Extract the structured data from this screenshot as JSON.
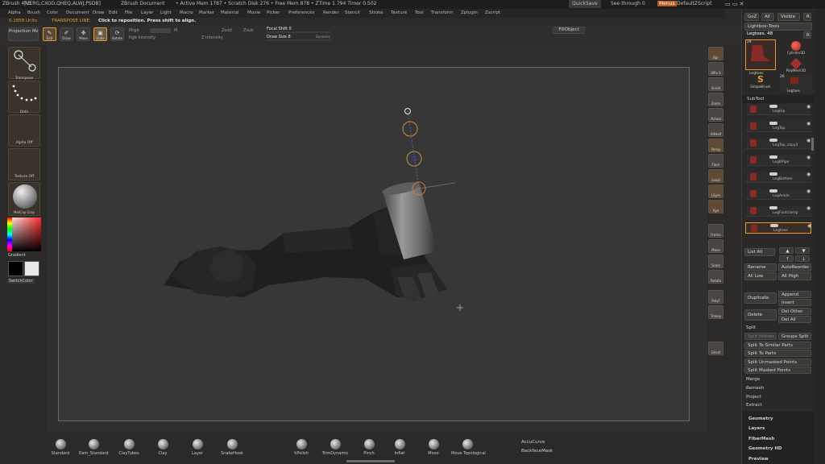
{
  "titlebar": {
    "app": "ZBrush 4R5",
    "build": "[VERG,CXOD,QHEQ,ALWJ,PSDB]",
    "doc": "ZBrush Document",
    "mem": "• Active Mem 1787 • Scratch Disk 276 • Free Mem 878 • ZTime 1.794 Timer 0.502",
    "quicksave": "QuickSave",
    "seethrough": "See-through 0",
    "menus": "Menus",
    "script": "DefaultZScript"
  },
  "menubar": [
    "Alpha",
    "Brush",
    "Color",
    "Document",
    "Draw",
    "Edit",
    "File",
    "Layer",
    "Light",
    "Macro",
    "Marker",
    "Material",
    "Movie",
    "Picker",
    "Preferences",
    "Render",
    "Stencil",
    "Stroke",
    "Texture",
    "Tool",
    "Transform",
    "Zplugin",
    "Zscript"
  ],
  "status": {
    "units": "0.1858 Units",
    "mode": "TRANSPOSE LINE:",
    "hint": "Click to reposition. Press shift to align."
  },
  "toolbar": {
    "projection_master": "Projection Master",
    "edit": "Edit",
    "draw": "Draw",
    "move": "Move",
    "scale": "Scale",
    "rotate": "Rotate",
    "mrgb": "Mrgb",
    "rgb": "Rgb",
    "m": "M",
    "zadd": "Zadd",
    "zsub": "Zsub",
    "rgb_intensity": "Rgb Intensity",
    "z_intensity": "Z Intensity",
    "focal_shift": "Focal Shift 0",
    "draw_size": "Draw Size 8",
    "dynamic": "Dynamic",
    "fill_object": "FillObject"
  },
  "left": {
    "transpose": "Transpose",
    "dots": "Dots",
    "alpha_off": "Alpha Off",
    "texture_off": "Texture Off",
    "material": "MatCap Gray",
    "gradient": "Gradient",
    "switch_color": "SwitchColor"
  },
  "right_shelf": [
    "Bpr",
    "SPix 3",
    "Scroll",
    "Zoom",
    "Actual",
    "AAHalf",
    "Persp",
    "Floor",
    "Local",
    "LSym",
    "Xyz",
    "Frame",
    "Move",
    "Scale",
    "Rotate",
    "PolyF",
    "Transp",
    "Ghost"
  ],
  "panel": {
    "goz": "GoZ",
    "all": "All",
    "visible": "Visible",
    "r": "R",
    "lightbox_tools": "Lightbox›Tools",
    "tool_name": "Legtoes. 48",
    "tools": [
      {
        "name": "Legtoes",
        "count": "24"
      },
      {
        "name": "Cylinder3D",
        "count": ""
      },
      {
        "name": "PolyMesh3D",
        "count": ""
      },
      {
        "name": "SimpleBrush",
        "count": ""
      },
      {
        "name": "Legtoes",
        "count": "26"
      }
    ],
    "subtool_title": "SubTool",
    "subtools": [
      "LegHip",
      "LegTop",
      "LegTop_copy1",
      "LegKPipe",
      "LegBottom",
      "LegAnkle",
      "LegFootclamp",
      "Legtoes"
    ],
    "list_all": "List All",
    "rename": "Rename",
    "auto_reorder": "AutoReorder",
    "all_low": "All Low",
    "all_high": "All High",
    "duplicate": "Duplicate",
    "append": "Append",
    "insert": "Insert",
    "delete": "Delete",
    "del_other": "Del Other",
    "del_all": "Del All",
    "split": "Split",
    "split_hidden": "Split Hidden",
    "groups_split": "Groups Split",
    "split_similar": "Split To Similar Parts",
    "split_parts": "Split To Parts",
    "split_unmasked": "Split Unmasked Points",
    "split_masked": "Split Masked Points",
    "merge": "Merge",
    "remesh": "Remesh",
    "project": "Project",
    "extract": "Extract",
    "geometry": "Geometry",
    "layers": "Layers",
    "fibermesh": "FiberMesh",
    "geometry_hd": "Geometry HD",
    "preview": "Preview"
  },
  "brushes": [
    "Standard",
    "Dam_Standard",
    "ClayTubes",
    "Clay",
    "Layer",
    "SnakeHook",
    "hPolish",
    "TrimDynamic",
    "Pinch",
    "Inflat",
    "Move",
    "Move Topological"
  ],
  "stroke": {
    "accucurve": "AccuCurve",
    "backface": "BackfaceMask"
  },
  "colors": {
    "accent": "#e59a2e",
    "bg": "#2b2a28"
  }
}
